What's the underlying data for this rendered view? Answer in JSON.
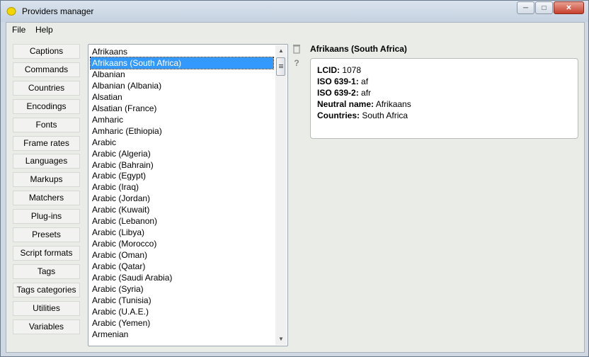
{
  "window": {
    "title": "Providers manager",
    "controls": [
      "minimize",
      "maximize",
      "close"
    ]
  },
  "menu": [
    "File",
    "Help"
  ],
  "nav": [
    "Captions",
    "Commands",
    "Countries",
    "Encodings",
    "Fonts",
    "Frame rates",
    "Languages",
    "Markups",
    "Matchers",
    "Plug-ins",
    "Presets",
    "Script formats",
    "Tags",
    "Tags categories",
    "Utilities",
    "Variables"
  ],
  "list": {
    "items": [
      "Afrikaans",
      "Afrikaans (South Africa)",
      "Albanian",
      "Albanian (Albania)",
      "Alsatian",
      "Alsatian (France)",
      "Amharic",
      "Amharic (Ethiopia)",
      "Arabic",
      "Arabic (Algeria)",
      "Arabic (Bahrain)",
      "Arabic (Egypt)",
      "Arabic (Iraq)",
      "Arabic (Jordan)",
      "Arabic (Kuwait)",
      "Arabic (Lebanon)",
      "Arabic (Libya)",
      "Arabic (Morocco)",
      "Arabic (Oman)",
      "Arabic (Qatar)",
      "Arabic (Saudi Arabia)",
      "Arabic (Syria)",
      "Arabic (Tunisia)",
      "Arabic (U.A.E.)",
      "Arabic (Yemen)",
      "Armenian"
    ],
    "selected_index": 1
  },
  "side_icons": [
    "delete-icon",
    "help-icon"
  ],
  "detail": {
    "title": "Afrikaans (South Africa)",
    "rows": [
      {
        "label": "LCID:",
        "value": "1078"
      },
      {
        "label": "ISO 639-1:",
        "value": "af"
      },
      {
        "label": "ISO 639-2:",
        "value": "afr"
      },
      {
        "label": "Neutral name:",
        "value": "Afrikaans"
      },
      {
        "label": "Countries:",
        "value": "South Africa"
      }
    ]
  },
  "colors": {
    "selection": "#3399ff",
    "client_bg": "#e9ece7",
    "titlebar": "#c6d2e0"
  }
}
